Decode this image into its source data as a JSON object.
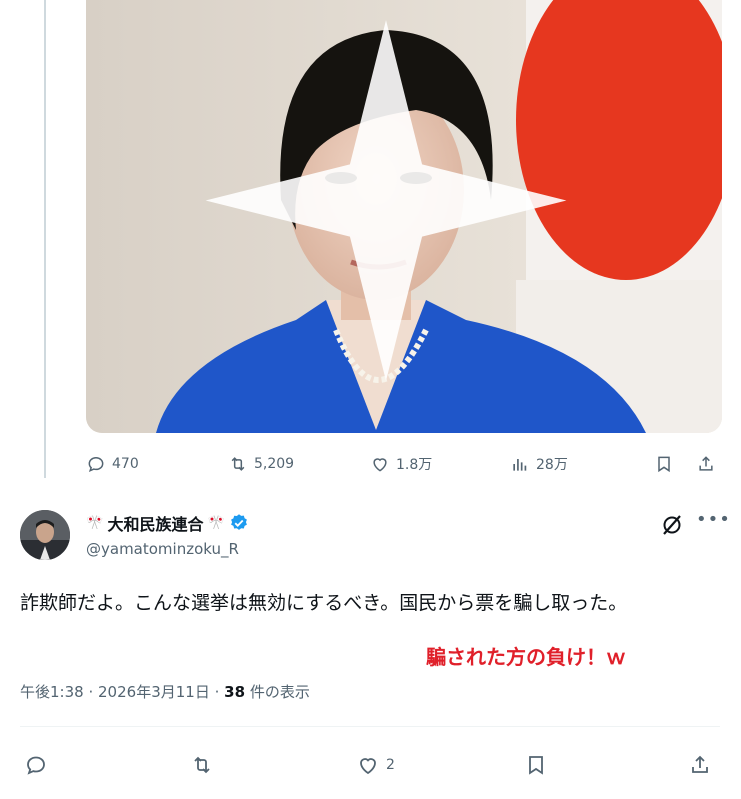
{
  "quoted_post": {
    "stats": {
      "replies": "470",
      "reposts": "5,209",
      "likes": "1.8万",
      "views": "28万"
    }
  },
  "post": {
    "author": {
      "display_name": "大和民族連合",
      "handle": "@yamatominzoku_R",
      "deco_left": "🎌",
      "deco_right": "🎌"
    },
    "text": "詐欺師だよ。こんな選挙は無効にするべき。国民から票を騙し取った。",
    "overlay_text": "騙された方の負け！ｗ",
    "time": "午後1:38",
    "date": "2026年3月11日",
    "view_count": "38",
    "view_label": "件の表示",
    "stats": {
      "likes": "2"
    }
  },
  "colors": {
    "text": "#0f1419",
    "secondary": "#536471",
    "verified": "#1d9bf0",
    "overlay": "#e0202a"
  },
  "icons": [
    "reply-icon",
    "repost-icon",
    "like-icon",
    "views-icon",
    "bookmark-icon",
    "share-icon",
    "verified-icon",
    "grok-icon",
    "more-icon"
  ]
}
